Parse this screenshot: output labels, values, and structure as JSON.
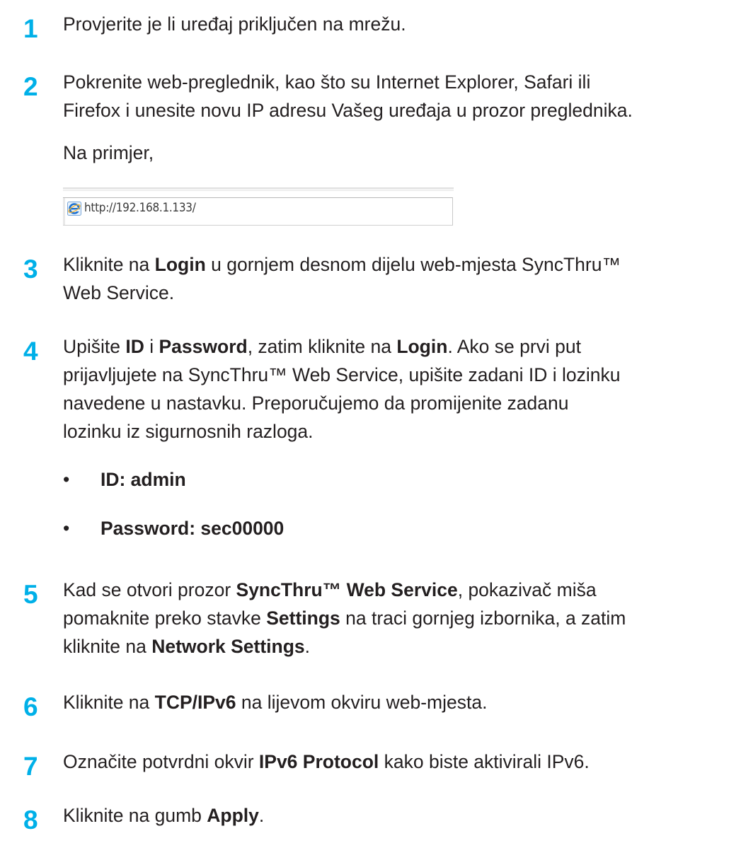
{
  "steps": [
    {
      "number": "1",
      "lines": [
        "Provjerite je li uređaj priključen na mrežu."
      ]
    },
    {
      "number": "2",
      "lines": [
        "Pokrenite web-preglednik, kao što su Internet Explorer, Safari ili",
        "Firefox i unesite novu IP adresu Vašeg uređaja u prozor preglednika."
      ],
      "example_label": "Na primjer,",
      "address_bar": {
        "url": "http://192.168.1.133/",
        "icon": "internet-explorer-icon"
      }
    },
    {
      "number": "3",
      "parts": [
        {
          "t": "Kliknite na "
        },
        {
          "t": "Login",
          "b": true
        },
        {
          "t": " u gornjem desnom dijelu web-mjesta SyncThru™"
        }
      ],
      "line2": "Web Service."
    },
    {
      "number": "4",
      "line1": [
        {
          "t": "Upišite "
        },
        {
          "t": "ID",
          "b": true
        },
        {
          "t": " i "
        },
        {
          "t": "Password",
          "b": true
        },
        {
          "t": ", zatim kliknite na "
        },
        {
          "t": "Login",
          "b": true
        },
        {
          "t": ". Ako se prvi put"
        }
      ],
      "line2": "prijavljujete na SyncThru™ Web Service, upišite zadani ID i lozinku",
      "line3": "navedene u nastavku. Preporučujemo da promijenite zadanu",
      "line4": "lozinku iz sigurnosnih razloga.",
      "bullets": [
        "ID: admin",
        "Password: sec00000"
      ]
    },
    {
      "number": "5",
      "line1": [
        {
          "t": "Kad se otvori prozor "
        },
        {
          "t": "SyncThru™ Web Service",
          "b": true
        },
        {
          "t": ", pokazivač miša"
        }
      ],
      "line2": [
        {
          "t": "pomaknite preko stavke "
        },
        {
          "t": "Settings",
          "b": true
        },
        {
          "t": " na traci gornjeg izbornika, a zatim"
        }
      ],
      "line3": [
        {
          "t": "kliknite na "
        },
        {
          "t": "Network Settings",
          "b": true
        },
        {
          "t": "."
        }
      ]
    },
    {
      "number": "6",
      "line1": [
        {
          "t": "Kliknite na "
        },
        {
          "t": "TCP/IPv6",
          "b": true
        },
        {
          "t": " na lijevom okviru web-mjesta."
        }
      ]
    },
    {
      "number": "7",
      "line1": [
        {
          "t": "Označite potvrdni okvir "
        },
        {
          "t": "IPv6 Protocol",
          "b": true
        },
        {
          "t": " kako biste aktivirali IPv6."
        }
      ]
    },
    {
      "number": "8",
      "line1": [
        {
          "t": "Kliknite na gumb "
        },
        {
          "t": "Apply",
          "b": true
        },
        {
          "t": "."
        }
      ]
    }
  ],
  "colors": {
    "step_number": "#00b0e8",
    "text": "#231f20"
  }
}
